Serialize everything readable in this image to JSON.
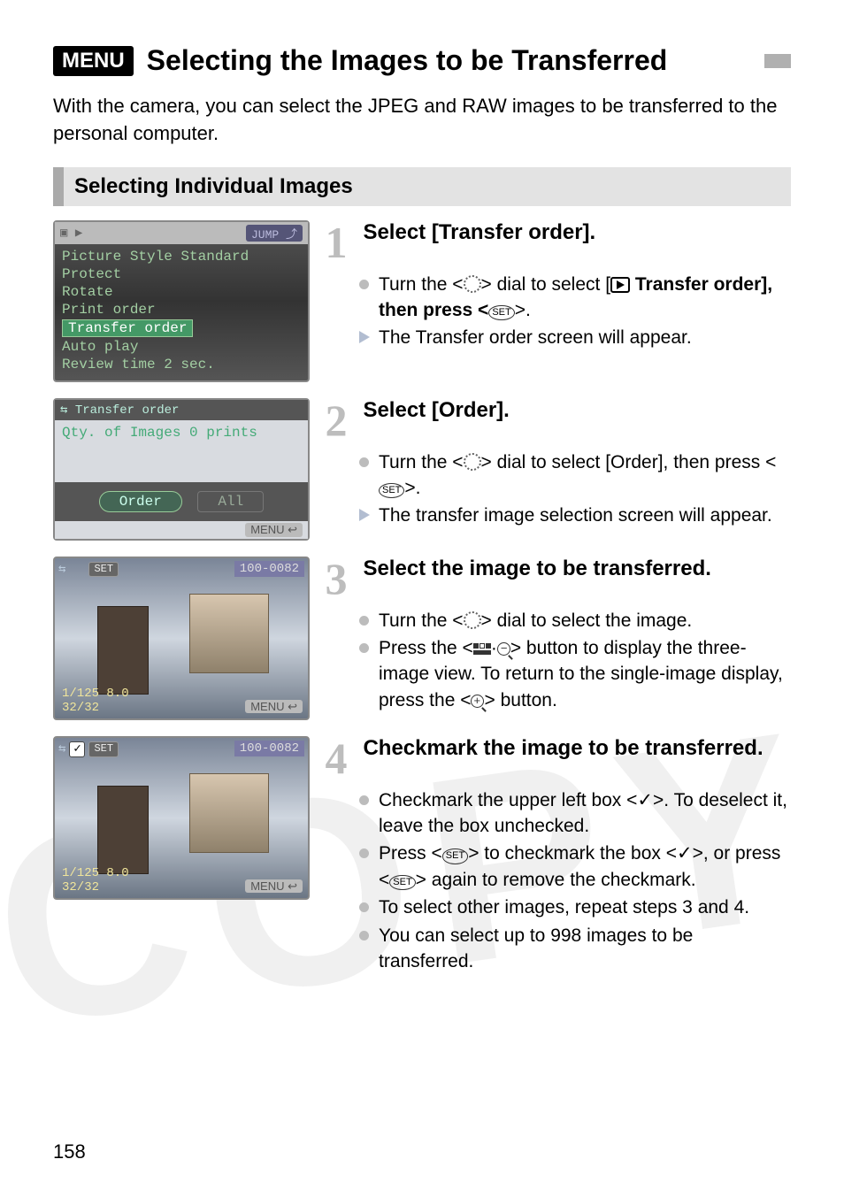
{
  "header": {
    "menu_badge": "MENU",
    "title": "Selecting the Images to be Transferred"
  },
  "intro": "With the camera, you can select the JPEG and RAW images to be transferred to the personal computer.",
  "section_title": "Selecting Individual Images",
  "screenshots": {
    "s1": {
      "hdr_icon": "▶",
      "jump": "JUMP",
      "rows": [
        "Picture Style   Standard",
        "Protect",
        "Rotate",
        "Print order",
        "Transfer order",
        "Auto play",
        "Review time     2 sec."
      ]
    },
    "s2": {
      "title": "Transfer order",
      "qty": "Qty. of Images 0 prints",
      "btn1": "Order",
      "btn2": "All",
      "footer": "MENU"
    },
    "s3": {
      "set": "SET",
      "id": "100-0082",
      "b1": "1/125  8.0",
      "b2": "32/32",
      "br": "MENU"
    },
    "s4": {
      "set": "SET",
      "id": "100-0082",
      "b1": "1/125  8.0",
      "b2": "32/32",
      "br": "MENU"
    }
  },
  "steps": {
    "s1": {
      "num": "1",
      "heading": "Select [Transfer order].",
      "b1a": "Turn the <",
      "b1b": "> dial to select [",
      "b1c": " Transfer order], then press <",
      "b1d": ">.",
      "b2": "The Transfer order screen will appear."
    },
    "s2": {
      "num": "2",
      "heading": "Select [Order].",
      "b1a": "Turn the <",
      "b1b": "> dial to select [Order], then press <",
      "b1c": ">.",
      "b2": "The transfer image selection screen will appear."
    },
    "s3": {
      "num": "3",
      "heading": "Select the image to be transferred.",
      "b1a": "Turn the <",
      "b1b": "> dial to select the image.",
      "b2a": "Press the <",
      "b2b": "> button to display the three-image view. To return to the single-image display, press the <",
      "b2c": "> button."
    },
    "s4": {
      "num": "4",
      "heading": "Checkmark the image to be transferred.",
      "b1a": "Checkmark the upper left box <",
      "b1b": ">. To deselect it, leave the box unchecked.",
      "b2a": "Press <",
      "b2b": "> to checkmark the box <",
      "b2c": ">, or press <",
      "b2d": "> again to remove the checkmark.",
      "b3": "To select other images, repeat steps 3 and 4.",
      "b4": "You can select up to 998 images to be transferred."
    }
  },
  "page_number": "158",
  "watermark": "COPY"
}
